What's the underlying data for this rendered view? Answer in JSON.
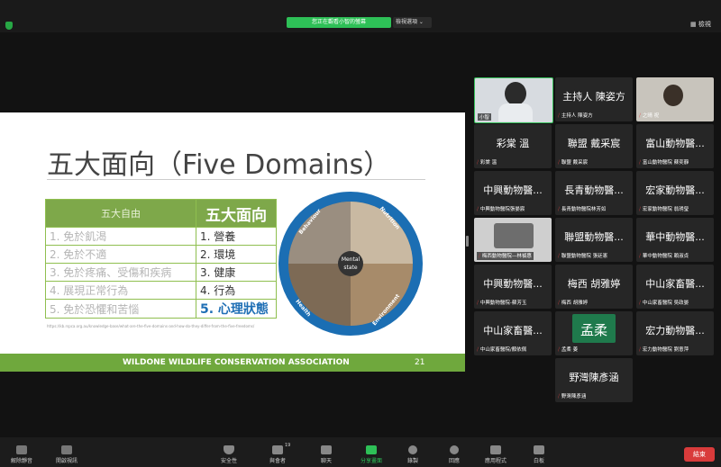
{
  "top": {
    "banner": "您正在觀看小智的螢幕",
    "view_options": "檢視選項",
    "view_button": "檢視"
  },
  "slide": {
    "title": "五大面向（Five Domains）",
    "table": {
      "head_left": "五大自由",
      "head_right": "五大面向",
      "rows": [
        {
          "left": "1. 免於飢渴",
          "right": "1. 營養"
        },
        {
          "left": "2. 免於不適",
          "right": "2. 環境"
        },
        {
          "left": "3. 免於疼痛、受傷和疾病",
          "right": "3. 健康"
        },
        {
          "left": "4. 展現正常行為",
          "right": "4. 行為"
        },
        {
          "left": "5. 免於恐懼和苦惱",
          "right": "5. 心理狀態"
        }
      ]
    },
    "source": "https://kb.rspca.org.au/knowledge-base/what-are-the-five-domains-and-how-do-they-differ-from-the-five-freedoms/",
    "circle": {
      "center": "Mental state",
      "labels": [
        "Behaviour",
        "Nutrition",
        "Health",
        "Environment"
      ]
    },
    "footer": "WILDONE WILDLIFE CONSERVATION ASSOCIATION",
    "page": "21"
  },
  "participants": [
    {
      "name": "",
      "sub": "小智",
      "type": "video"
    },
    {
      "name": "主持人 陳姿方",
      "sub": "主持人 陳姿方",
      "type": "name"
    },
    {
      "name": "",
      "sub": "之晴 祝",
      "type": "video"
    },
    {
      "name": "彩棠 溫",
      "sub": "彩棠 溫",
      "type": "name"
    },
    {
      "name": "聯盟 戴采宸",
      "sub": "聯盟 戴采宸",
      "type": "name"
    },
    {
      "name": "富山動物醫...",
      "sub": "富山動物醫院 蘇奕靜",
      "type": "name"
    },
    {
      "name": "中興動物醫...",
      "sub": "中興動物醫院張晏宸",
      "type": "name"
    },
    {
      "name": "長青動物醫...",
      "sub": "長青動物醫院林芳如",
      "type": "name"
    },
    {
      "name": "宏家動物醫...",
      "sub": "宏家動物醫院 翁琇瑩",
      "type": "name"
    },
    {
      "name": "",
      "sub": "梅西動物醫院—林禎惠",
      "type": "video"
    },
    {
      "name": "聯盟動物醫...",
      "sub": "聯盟動物醫院 張廷憲",
      "type": "name"
    },
    {
      "name": "華中動物醫...",
      "sub": "華中動物醫院 賴淑貞",
      "type": "name"
    },
    {
      "name": "中興動物醫...",
      "sub": "中興動物醫院-蘇芳玉",
      "type": "name"
    },
    {
      "name": "梅西 胡雅婷",
      "sub": "梅西 胡雅婷",
      "type": "name"
    },
    {
      "name": "中山家畜醫...",
      "sub": "中山家畜醫院 吳政晏",
      "type": "name"
    },
    {
      "name": "中山家畜醫...",
      "sub": "中山家畜醫院/顏依佩",
      "type": "name"
    },
    {
      "name": "孟柔",
      "sub": "孟柔 姜",
      "type": "avatar"
    },
    {
      "name": "宏力動物醫...",
      "sub": "宏力動物醫院 劉意萍",
      "type": "name"
    },
    {
      "name": "野灣陳彥涵",
      "sub": "野灣陳彥涵",
      "type": "name"
    }
  ],
  "toolbar": {
    "unmute": "解除靜音",
    "start_video": "開啟視訊",
    "security": "安全性",
    "participants": "與會者",
    "participant_count": "19",
    "chat": "聊天",
    "share": "分享畫面",
    "record": "錄製",
    "reactions": "回應",
    "apps": "應用程式",
    "whiteboard": "白板",
    "end": "結束"
  }
}
